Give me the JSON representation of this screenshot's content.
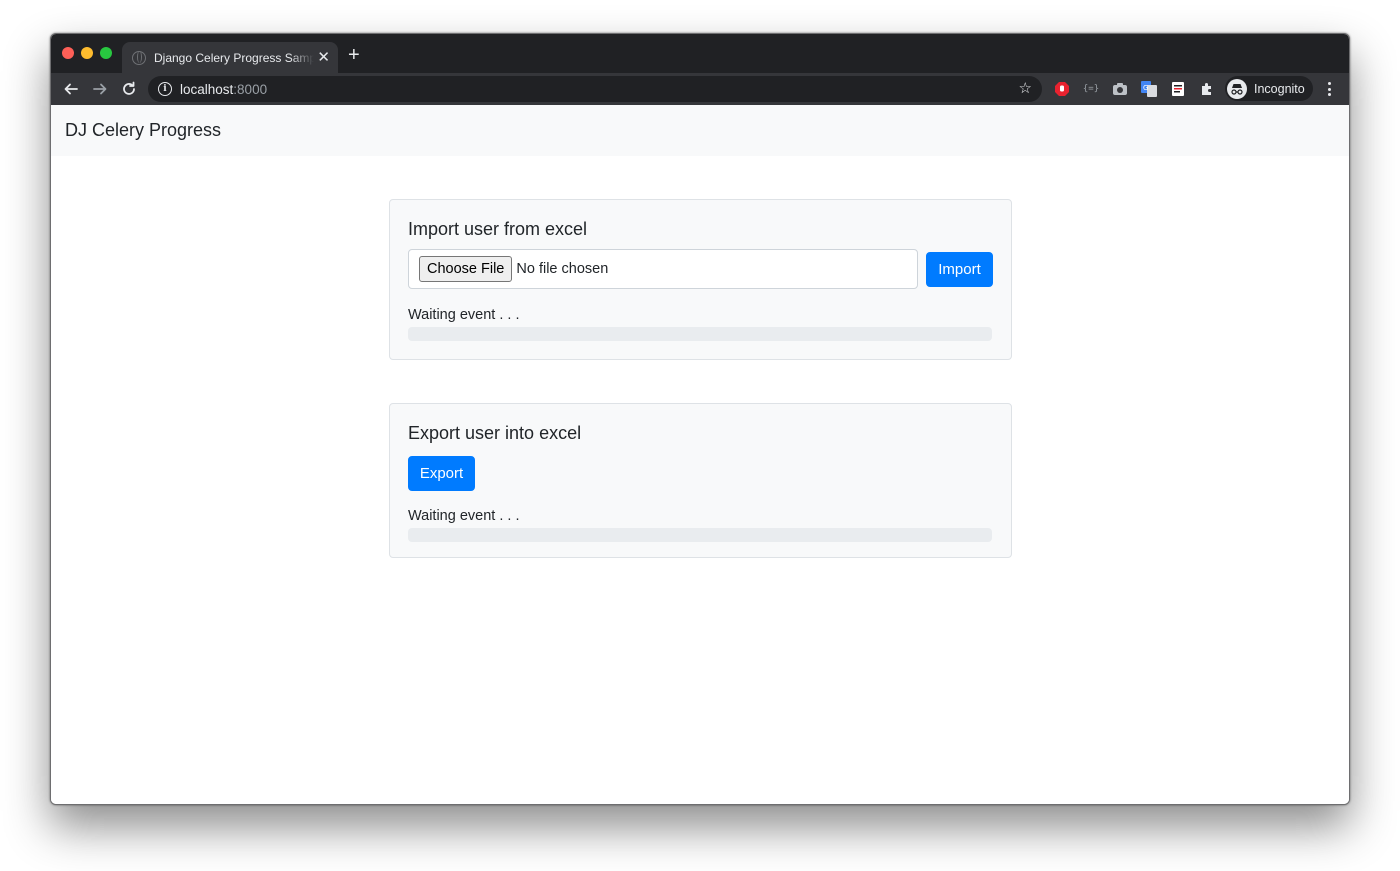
{
  "browser": {
    "tab_title": "Django Celery Progress Sample",
    "url_host": "localhost",
    "url_port": ":8000",
    "profile_label": "Incognito"
  },
  "navbar": {
    "brand": "DJ Celery Progress"
  },
  "import_card": {
    "title": "Import user from excel",
    "choose_file_label": "Choose File",
    "file_status": "No file chosen",
    "button_label": "Import",
    "status_text": "Waiting event . . .",
    "progress": 0
  },
  "export_card": {
    "title": "Export user into excel",
    "button_label": "Export",
    "status_text": "Waiting event . . .",
    "progress": 0
  },
  "colors": {
    "primary": "#007bff",
    "navbar_bg": "#f8f9fa",
    "progress_track": "#e9ecef"
  }
}
